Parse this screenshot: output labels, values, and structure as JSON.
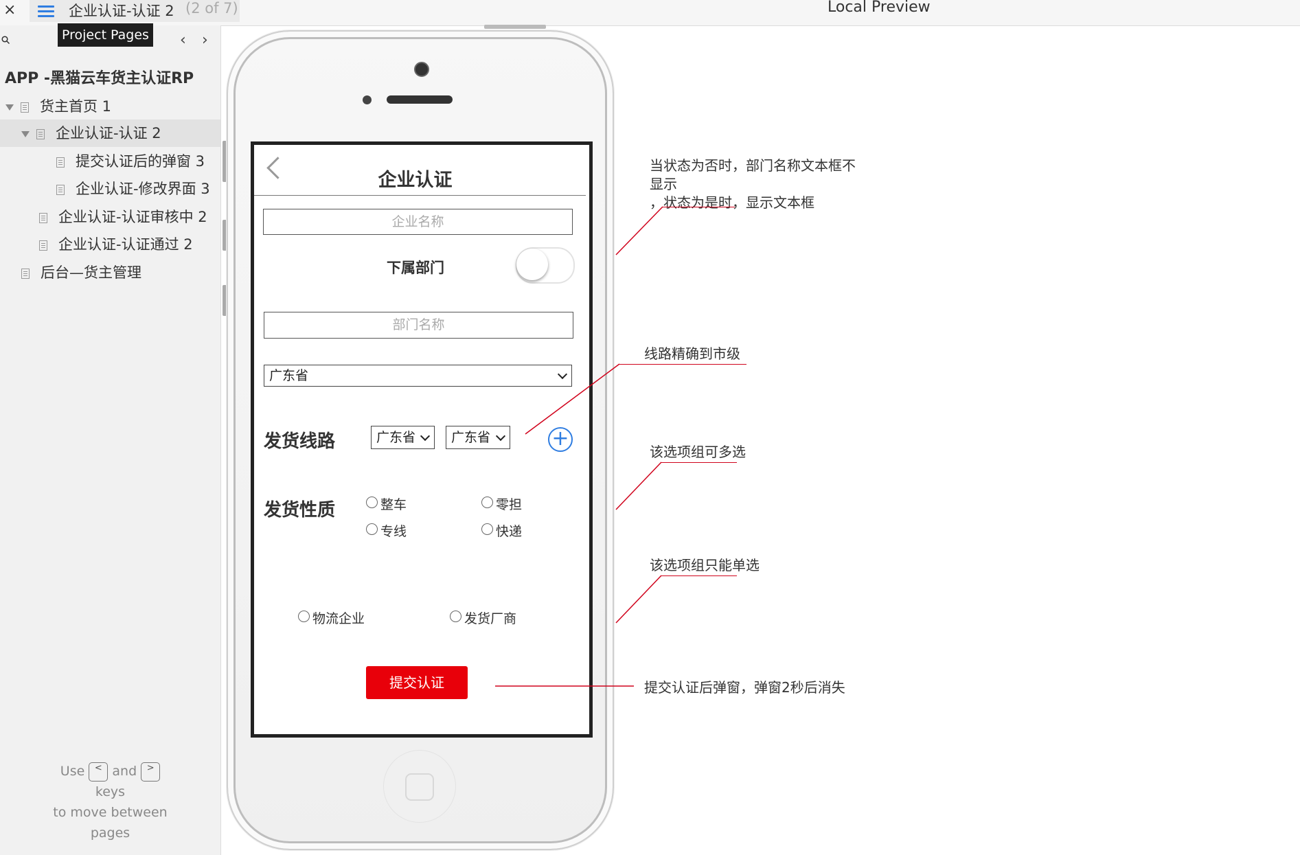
{
  "topbar": {
    "close_label": "×",
    "page_name": "企业认证-认证 2",
    "page_count": "(2 of 7)",
    "preview_title": "Local Preview"
  },
  "sidebar": {
    "tooltip": "Project Pages",
    "prev_label": "‹",
    "next_label": "›",
    "project_title": "APP -黑猫云车货主认证RP",
    "items": [
      {
        "label": "货主首页 1"
      },
      {
        "label": "企业认证-认证 2"
      },
      {
        "label": "提交认证后的弹窗 3"
      },
      {
        "label": "企业认证-修改界面 3"
      },
      {
        "label": "企业认证-认证审核中 2"
      },
      {
        "label": "企业认证-认证通过 2"
      },
      {
        "label": "后台—货主管理"
      }
    ],
    "help": {
      "use": "Use",
      "and": "and",
      "prev_key": "<",
      "next_key": ">",
      "keys": "keys",
      "line3": "to move between",
      "line4": "pages"
    }
  },
  "screen": {
    "title": "企业认证",
    "company_placeholder": "企业名称",
    "dept_label": "下属部门",
    "toggle_on": false,
    "dept_placeholder": "部门名称",
    "province_select": "广东省",
    "route_label": "发货线路",
    "route_from": "广东省",
    "route_to": "广东省",
    "nature_label": "发货性质",
    "nature_options": [
      "整车",
      "零担",
      "专线",
      "快递"
    ],
    "type_options": [
      "物流企业",
      "发货厂商"
    ],
    "submit_label": "提交认证"
  },
  "annotations": {
    "note1_line1": "当状态为否时，部门名称文本框不",
    "note1_line2": "显示",
    "note1_line3": "，状态为是时，显示文本框",
    "note2": "线路精确到市级",
    "note3": "该选项组可多选",
    "note4": "该选项组只能单选",
    "note5": "提交认证后弹窗，弹窗2秒后消失",
    "line_color": "#d0021b"
  },
  "colors": {
    "accent": "#2f7de1",
    "submit": "#e8000a"
  }
}
